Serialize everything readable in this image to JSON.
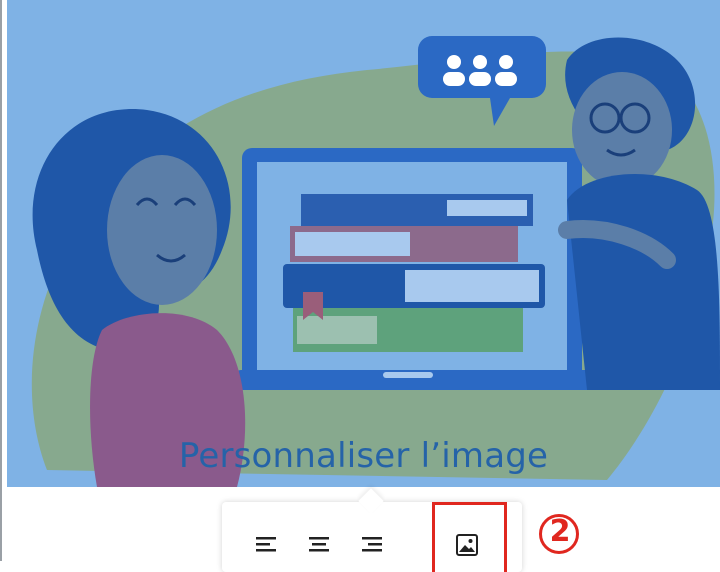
{
  "hero": {
    "caption": "Personnaliser l’image"
  },
  "toolbar": {
    "buttons": [
      {
        "name": "align-left-icon"
      },
      {
        "name": "align-center-icon"
      },
      {
        "name": "align-right-icon"
      },
      {
        "name": "image-icon"
      }
    ]
  },
  "annotation": {
    "step": "2"
  },
  "colors": {
    "highlight": "#e0271f",
    "caption": "#2563a8",
    "hero_bg": "#7fb2e5"
  }
}
